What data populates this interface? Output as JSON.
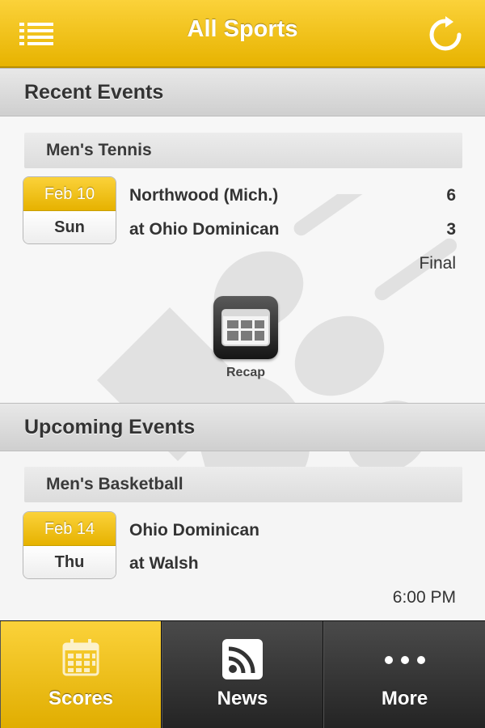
{
  "header": {
    "title": "All Sports",
    "menu_icon": "list-menu-icon",
    "refresh_icon": "refresh-icon"
  },
  "recent": {
    "section_title": "Recent Events",
    "sport": "Men's Tennis",
    "date": {
      "month_day": "Feb 10",
      "weekday": "Sun"
    },
    "team1": "Northwood (Mich.)",
    "score1": "6",
    "team2": "at Ohio Dominican",
    "score2": "3",
    "status": "Final",
    "recap_label": "Recap",
    "recap_icon": "recap-document-icon"
  },
  "upcoming": {
    "section_title": "Upcoming Events",
    "sport": "Men's Basketball",
    "date": {
      "month_day": "Feb 14",
      "weekday": "Thu"
    },
    "team1": "Ohio Dominican",
    "team2": "at Walsh",
    "time": "6:00 PM"
  },
  "tabs": [
    {
      "label": "Scores",
      "icon": "calendar-icon",
      "active": true
    },
    {
      "label": "News",
      "icon": "rss-icon",
      "active": false
    },
    {
      "label": "More",
      "icon": "more-dots-icon",
      "active": false
    }
  ],
  "colors": {
    "accent": "#f2c31a",
    "tabbar": "#333333"
  }
}
